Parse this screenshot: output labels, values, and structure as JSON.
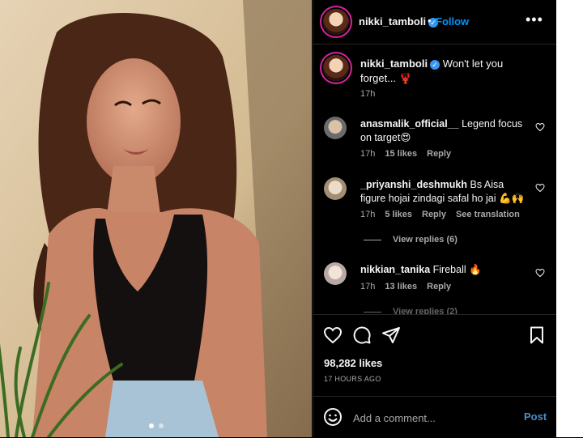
{
  "post": {
    "username": "nikki_tamboli",
    "follow_label": "Follow",
    "separator": "•",
    "more_label": "•••",
    "caption": "Won't let you forget... 🦞",
    "caption_time": "17h",
    "likes": "98,282 likes",
    "posted": "17 HOURS AGO",
    "image_dots": 2,
    "active_dot": 0
  },
  "comments": [
    {
      "username": "anasmalik_official__",
      "text": "Legend focus on target😍",
      "time": "17h",
      "likes": "15 likes",
      "reply_label": "Reply"
    },
    {
      "username": "_priyanshi_deshmukh",
      "text": "Bs Aisa figure hojai zindagi safal ho jai 💪🙌",
      "time": "17h",
      "likes": "5 likes",
      "reply_label": "Reply",
      "translate_label": "See translation",
      "view_replies": "View replies (6)"
    },
    {
      "username": "nikkian_tanika",
      "text": "Fireball 🔥",
      "time": "17h",
      "likes": "13 likes",
      "reply_label": "Reply",
      "view_replies": "View replies (2)"
    }
  ],
  "composer": {
    "placeholder": "Add a comment...",
    "post_label": "Post"
  },
  "colors": {
    "accent": "#0095f6",
    "background": "#000000",
    "muted": "#a8a8a8"
  },
  "icons": [
    "more-icon",
    "verified-icon",
    "heart-icon",
    "comment-icon",
    "share-icon",
    "save-icon",
    "emoji-icon"
  ]
}
